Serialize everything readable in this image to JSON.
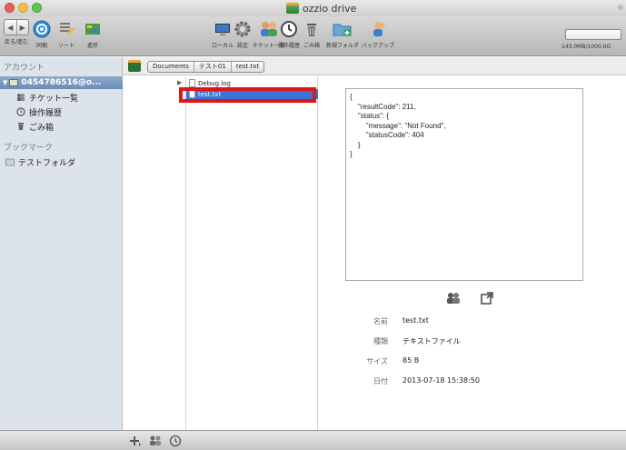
{
  "window": {
    "title": "ozzio drive"
  },
  "toolbar": {
    "back_forward_label": "戻る/進む",
    "sync_label": "同期",
    "sort_label": "ソート",
    "progress_label": "進捗",
    "local_label": "ローカル",
    "settings_label": "設定",
    "tickets_label": "チケット一覧",
    "history_label": "操作履歴",
    "trash_label": "ごみ箱",
    "new_folder_label": "新規フォルダ",
    "backup_label": "バックアップ",
    "storage": "143.0MB/1000.0G"
  },
  "sidebar": {
    "accounts_heading": "アカウント",
    "account_label": "0454786516@o...",
    "items": [
      {
        "label": "チケット一覧"
      },
      {
        "label": "操作履歴"
      },
      {
        "label": "ごみ箱"
      }
    ],
    "bookmarks_heading": "ブックマーク",
    "bookmarks": [
      {
        "label": "テストフォルダ"
      }
    ]
  },
  "pathbar": {
    "crumbs": [
      "Documents",
      "テスト01",
      "test.txt"
    ]
  },
  "files": [
    {
      "name": "Debug.log"
    },
    {
      "name": "test.txt"
    }
  ],
  "preview": {
    "content": "{\n    \"resultCode\": 211,\n    \"status\": {\n        \"message\": \"Not Found\",\n        \"statusCode\": 404\n    }\n}"
  },
  "info": {
    "name_label": "名前",
    "name_value": "test.txt",
    "kind_label": "種類",
    "kind_value": "テキストファイル",
    "size_label": "サイズ",
    "size_value": "85 B",
    "date_label": "日付",
    "date_value": "2013-07-18 15:38:50"
  },
  "colors": {
    "selection": "#3875d7",
    "highlight": "#e0141b",
    "sidebar_bg": "#dde3ea"
  }
}
